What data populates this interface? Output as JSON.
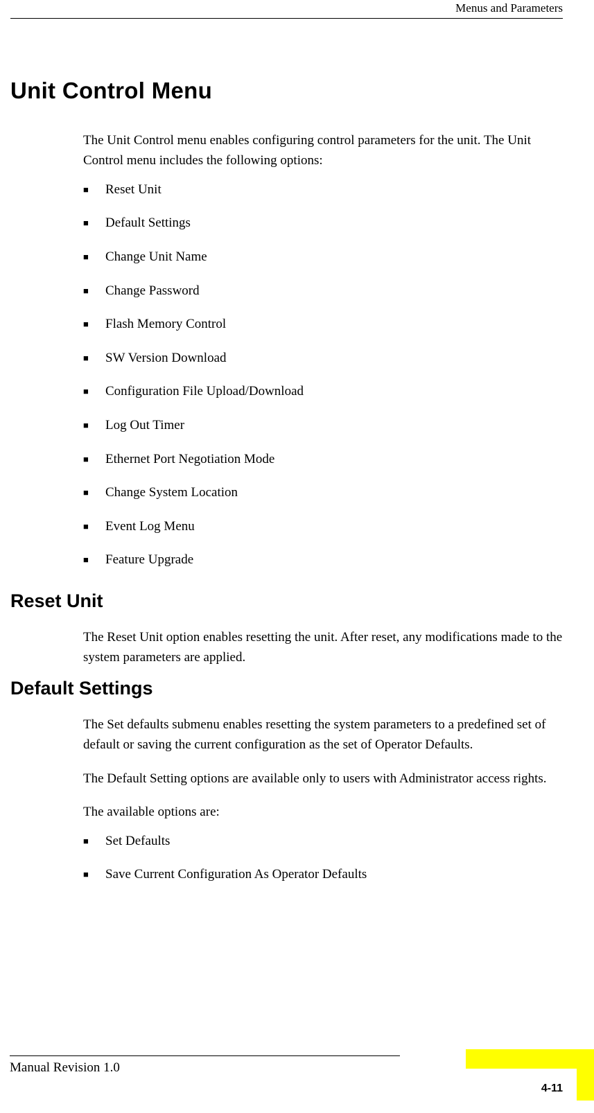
{
  "header": {
    "section_title": "Menus and Parameters"
  },
  "main": {
    "h1": "Unit Control Menu",
    "intro": "The Unit Control menu enables configuring control parameters for the unit. The Unit Control menu includes the following options:",
    "options": [
      "Reset Unit",
      "Default Settings",
      "Change Unit Name",
      "Change Password",
      "Flash Memory Control",
      "SW Version Download",
      "Configuration File Upload/Download",
      "Log Out Timer",
      "Ethernet Port Negotiation Mode",
      "Change System Location",
      "Event Log Menu",
      "Feature Upgrade"
    ],
    "sections": [
      {
        "title": "Reset Unit",
        "paragraphs": [
          "The Reset Unit option enables resetting the unit. After reset, any modifications made to the system parameters are applied."
        ]
      },
      {
        "title": "Default Settings",
        "paragraphs": [
          "The Set defaults submenu enables resetting the system parameters to a predefined set of default or saving the current configuration as the set of Operator Defaults.",
          "The Default Setting options are available only to users with Administrator access rights.",
          "The available options are:"
        ],
        "bullets": [
          "Set Defaults",
          "Save Current Configuration As Operator Defaults"
        ]
      }
    ]
  },
  "footer": {
    "revision": "Manual Revision 1.0",
    "page_number": "4-11"
  }
}
